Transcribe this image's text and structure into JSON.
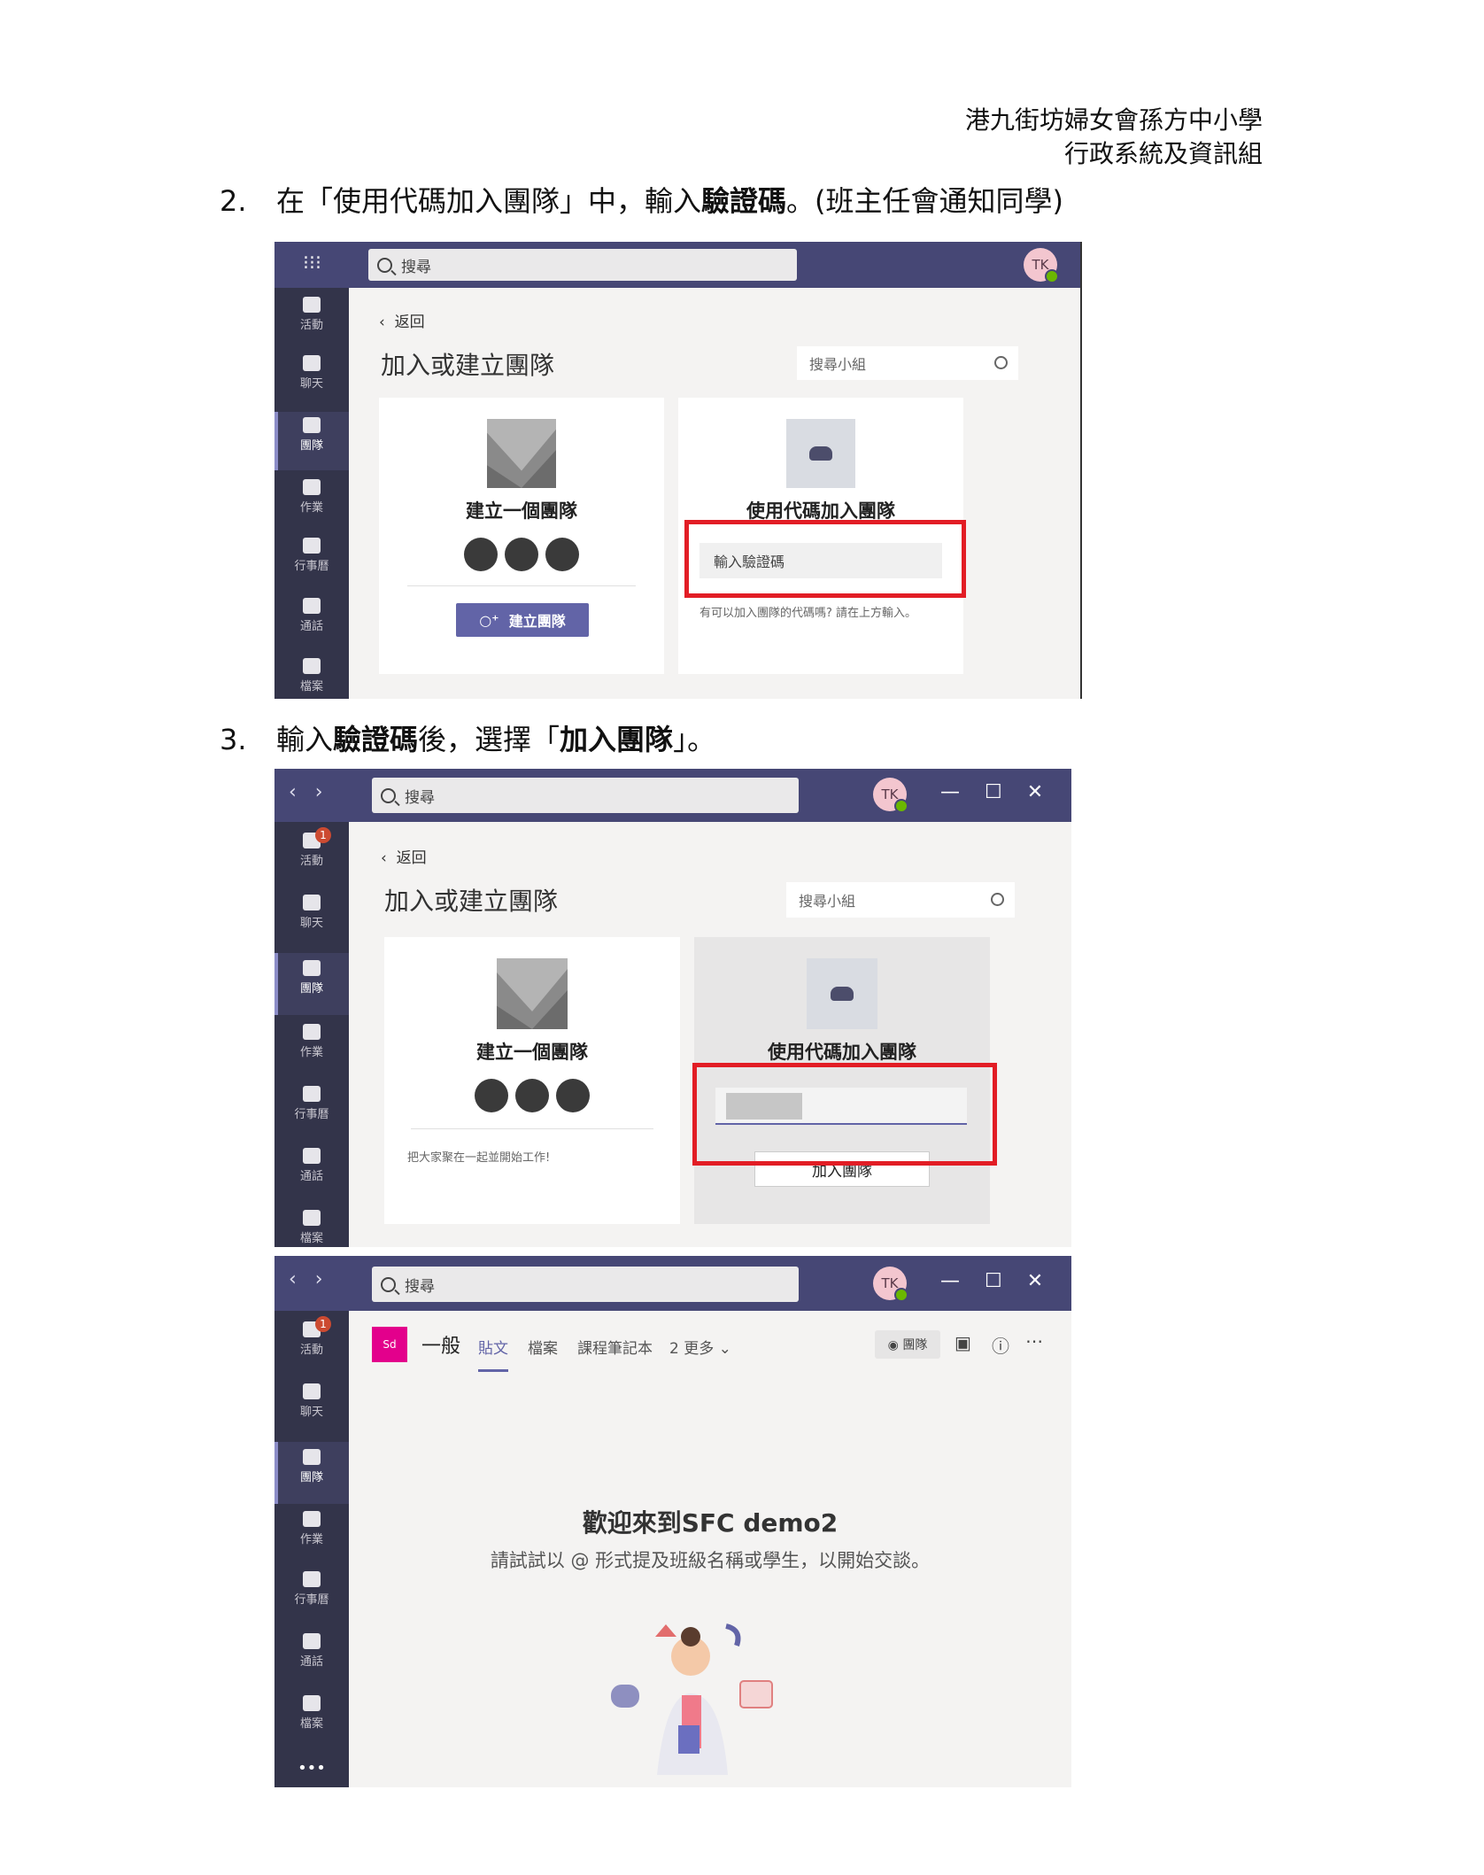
{
  "header": {
    "school": "港九街坊婦女會孫方中小學",
    "dept": "行政系統及資訊組"
  },
  "step2": {
    "number": "2.",
    "text_a": "在「使用代碼加入團隊」中，輸入",
    "text_bold": "驗證碼",
    "text_b": "。(班主任會通知同學)"
  },
  "step3": {
    "number": "3.",
    "text_a": "輸入",
    "text_bold1": "驗證碼",
    "text_b": "後，選擇「",
    "text_bold2": "加入團隊",
    "text_c": "」。"
  },
  "rail": {
    "activity": "活動",
    "chat": "聊天",
    "teams": "團隊",
    "assignments": "作業",
    "calendar": "行事曆",
    "calls": "通話",
    "files": "檔案",
    "more": "•••",
    "activity_badge": "1"
  },
  "common": {
    "search_placeholder": "搜尋",
    "avatar": "TK",
    "back": "返回",
    "page_title": "加入或建立團隊",
    "team_search": "搜尋小組",
    "create_title": "建立一個團隊",
    "code_title": "使用代碼加入團隊"
  },
  "screen1": {
    "create_button": "建立團隊",
    "code_placeholder": "輸入驗證碼",
    "hint": "有可以加入團隊的代碼嗎? 請在上方輸入。"
  },
  "screen2": {
    "create_desc": "把大家聚在一起並開始工作!",
    "join_button": "加入團隊"
  },
  "screen3": {
    "team_tile": "Sd",
    "channel": "一般",
    "tabs": [
      "貼文",
      "檔案",
      "課程筆記本",
      "2 更多 ⌄"
    ],
    "team_button": "◉ 團隊",
    "welcome": "歡迎來到SFC demo2",
    "welcome_sub": "請試試以 @ 形式提及班級名稱或學生，以開始交談。"
  },
  "window_controls": {
    "minimize": "—",
    "maximize": "☐",
    "close": "✕",
    "back": "‹",
    "forward": "›"
  },
  "colors": {
    "topbar": "#464775",
    "rail": "#33344a",
    "accent": "#6264a7",
    "highlight": "#e21d25"
  }
}
